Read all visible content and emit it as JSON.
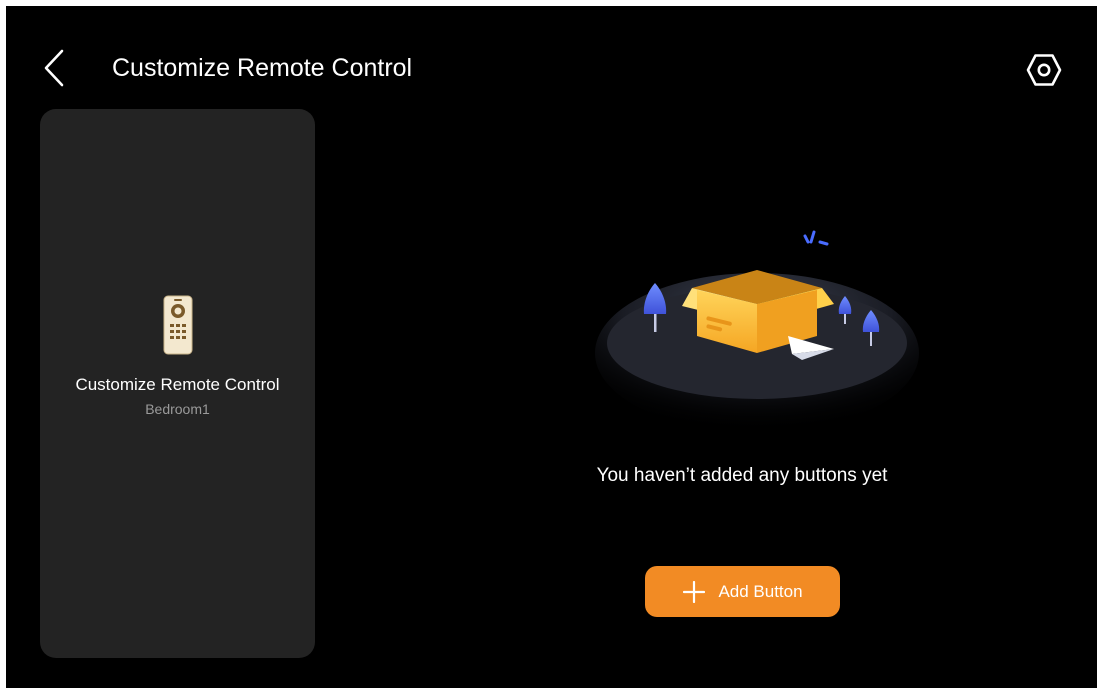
{
  "header": {
    "title": "Customize Remote Control",
    "back_icon": "chevron-left-icon",
    "settings_icon": "hexagon-settings-icon"
  },
  "device_card": {
    "icon": "remote-control-icon",
    "name": "Customize Remote Control",
    "room": "Bedroom1"
  },
  "empty_state": {
    "illustration": "empty-box-illustration",
    "message": "You haven’t added any buttons yet"
  },
  "add_button": {
    "icon": "plus-icon",
    "label": "Add Button"
  },
  "colors": {
    "background": "#000000",
    "card": "#232323",
    "accent": "#f28b24",
    "text_primary": "#ffffff",
    "text_secondary": "#9a9a9a"
  }
}
